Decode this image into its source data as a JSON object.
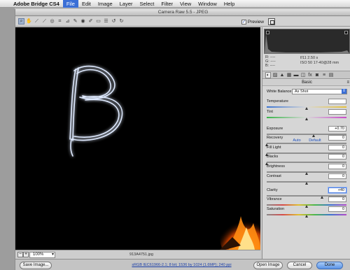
{
  "menubar": {
    "app_name": "Adobe Bridge CS4",
    "items": [
      "File",
      "Edit",
      "Image",
      "Layer",
      "Select",
      "Filter",
      "View",
      "Window",
      "Help"
    ]
  },
  "window": {
    "title": "Camera Raw 5.5  -  JPEG"
  },
  "toolbar": {
    "tools": [
      "zoom-icon",
      "hand-icon",
      "white-balance-icon",
      "color-sampler-icon",
      "target-adjust-icon",
      "crop-icon",
      "straighten-icon",
      "spot-removal-icon",
      "red-eye-icon",
      "adjustment-brush-icon",
      "graduated-filter-icon",
      "preferences-icon",
      "rotate-left-icon",
      "rotate-right-icon"
    ],
    "preview_label": "Preview",
    "preview_checked": true
  },
  "canvas": {
    "zoom_value": "100%",
    "filename": "913A4751.jpg"
  },
  "readout": {
    "r": "R:   ----",
    "g": "G:   ----",
    "b": "B:   ----",
    "aperture_shutter": "f/11    2.50 s",
    "iso_lens": "ISO 50    17-40@28 mm"
  },
  "panel": {
    "section_title": "Basic",
    "white_balance_label": "White Balance:",
    "white_balance_value": "As Shot",
    "auto_label": "Auto",
    "default_label": "Default"
  },
  "sliders": [
    {
      "label": "Temperature",
      "value": "",
      "fraction": 0.5,
      "gradient": "linear-gradient(90deg,#3b74d1,#d8d8d8,#e6c23a)"
    },
    {
      "label": "Tint",
      "value": "",
      "fraction": 0.5,
      "gradient": "linear-gradient(90deg,#39b54a,#d8d8d8,#c94ac9)"
    },
    {
      "label": "Exposure",
      "value": "+0.70",
      "fraction": 0.59
    },
    {
      "label": "Recovery",
      "value": "0",
      "fraction": 0.0
    },
    {
      "label": "Fill Light",
      "value": "0",
      "fraction": 0.0
    },
    {
      "label": "Blacks",
      "value": "0",
      "fraction": 0.0
    },
    {
      "label": "Brightness",
      "value": "0",
      "fraction": 0.5
    },
    {
      "label": "Contrast",
      "value": "0",
      "fraction": 0.5
    },
    {
      "label": "Clarity",
      "value": "+40",
      "fraction": 0.7,
      "focused": true
    },
    {
      "label": "Vibrance",
      "value": "0",
      "fraction": 0.5,
      "gradient": "linear-gradient(90deg,#8a8a8a,#d64a4a,#e0c030,#4ab84a,#3b74d1,#b44ac8)"
    },
    {
      "label": "Saturation",
      "value": "0",
      "fraction": 0.5,
      "gradient": "linear-gradient(90deg,#8a8a8a,#d64a4a,#e0c030,#4ab84a,#3b74d1,#b44ac8)"
    }
  ],
  "bottom": {
    "save_label": "Save Image...",
    "workflow_text": "sRGB IEC61966-2.1; 8 bit; 1536 by 1024 (1.6MP); 240 ppi",
    "open_label": "Open Image",
    "cancel_label": "Cancel",
    "done_label": "Done"
  },
  "colors": {
    "accent": "#3b6fd6",
    "canvas_bg": "#000000",
    "light_trail": "#dfeaff"
  }
}
